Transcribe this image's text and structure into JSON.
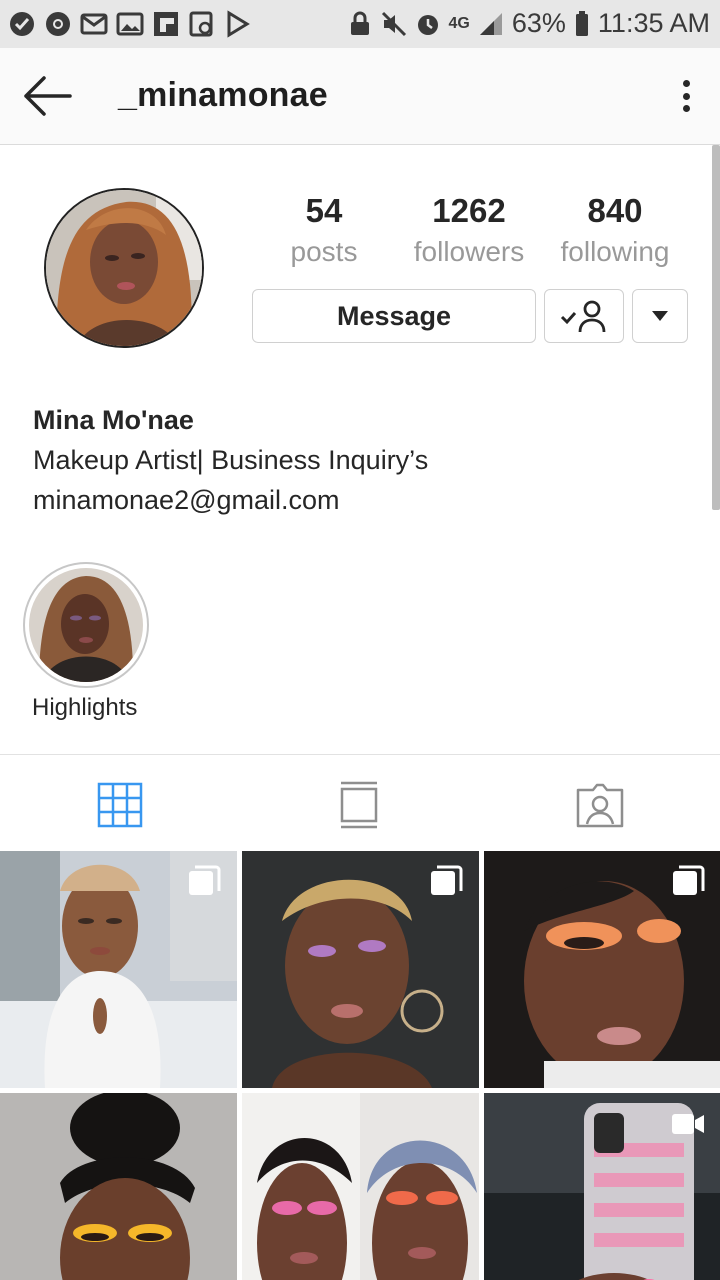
{
  "status_bar": {
    "battery": "63%",
    "time": "11:35 AM",
    "network": "4G"
  },
  "header": {
    "username": "_minamonae"
  },
  "stats": {
    "posts_count": "54",
    "posts_label": "posts",
    "followers_count": "1262",
    "followers_label": "followers",
    "following_count": "840",
    "following_label": "following"
  },
  "actions": {
    "message_label": "Message"
  },
  "bio": {
    "name": "Mina Mo'nae",
    "line1": "Makeup Artist| Business Inquiry’s",
    "line2": "minamonae2@gmail.com"
  },
  "highlights": [
    {
      "label": "Highlights"
    }
  ],
  "tabs": [
    "grid-icon",
    "feed-icon",
    "tagged-icon"
  ],
  "colors": {
    "accent_blue": "#3897f0",
    "muted_text": "#999999",
    "border": "#dbdbdb"
  },
  "posts": [
    {
      "type": "carousel"
    },
    {
      "type": "carousel"
    },
    {
      "type": "carousel"
    },
    {
      "type": "photo"
    },
    {
      "type": "photo"
    },
    {
      "type": "video"
    }
  ]
}
